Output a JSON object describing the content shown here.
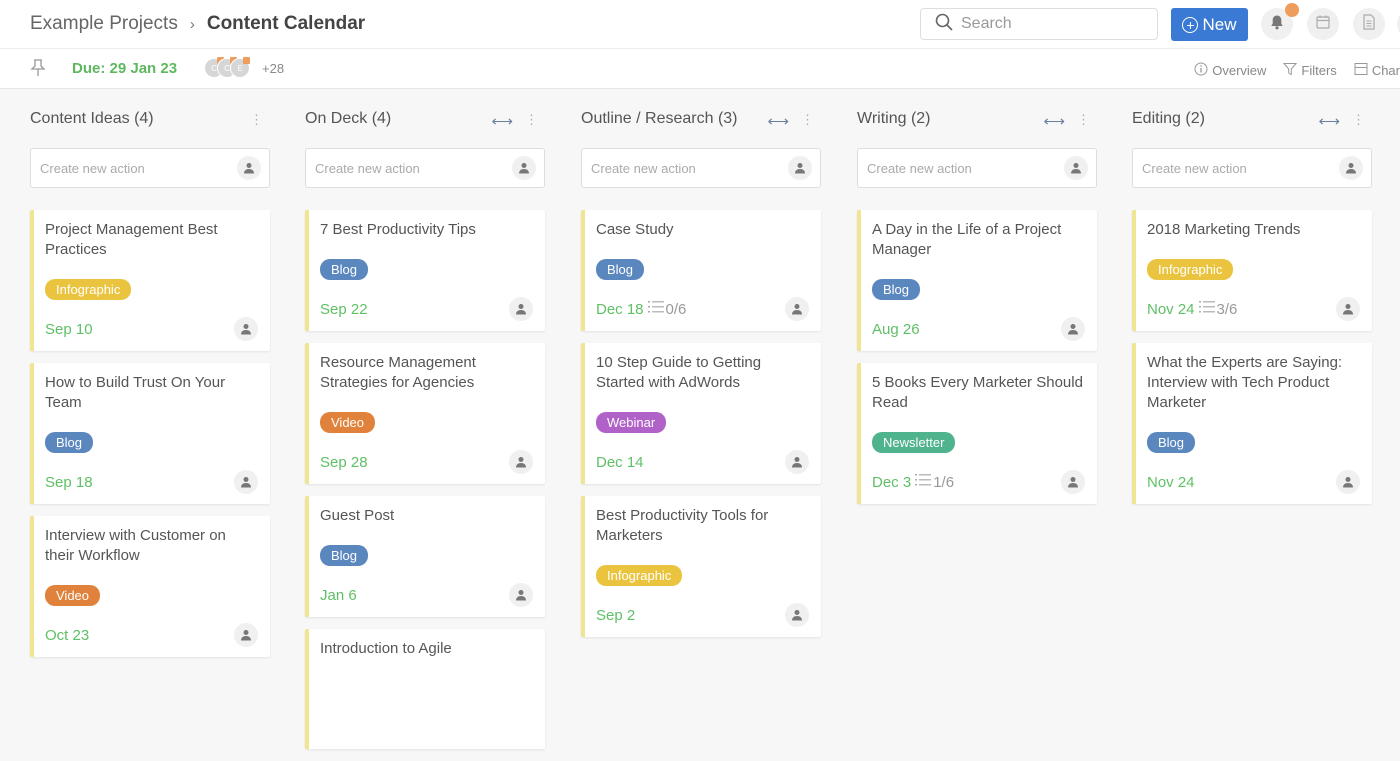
{
  "header": {
    "breadcrumb_parent": "Example Projects",
    "breadcrumb_sep": "›",
    "breadcrumb_current": "Content Calendar",
    "search_placeholder": "Search",
    "new_label": "New",
    "notification_color": "#ee9d5c"
  },
  "subbar": {
    "due": "Due: 29 Jan 23",
    "avatars": [
      "C",
      "C",
      "E"
    ],
    "more_count": "+28",
    "links": {
      "overview": "Overview",
      "filters": "Filters",
      "chart": "Char"
    }
  },
  "colors": {
    "accent": "#3b7ad4",
    "date": "#5fc066",
    "card_border": "#efe592"
  },
  "tag_colors": {
    "Blog": "#5b87bf",
    "Infographic": "#ebc43f",
    "Video": "#e0823b",
    "Webinar": "#b062c8",
    "Newsletter": "#4fb38e"
  },
  "create_placeholder": "Create new action",
  "columns": [
    {
      "title": "Content Ideas (4)",
      "expand": false,
      "cards": [
        {
          "title": "Project Management Best Practices",
          "tag": "Infographic",
          "date": "Sep 10",
          "checklist": ""
        },
        {
          "title": "How to Build Trust On Your Team",
          "tag": "Blog",
          "date": "Sep 18",
          "checklist": ""
        },
        {
          "title": "Interview with Customer on their Workflow",
          "tag": "Video",
          "date": "Oct 23",
          "checklist": ""
        }
      ]
    },
    {
      "title": "On Deck (4)",
      "expand": true,
      "cards": [
        {
          "title": "7 Best Productivity Tips",
          "tag": "Blog",
          "date": "Sep 22",
          "checklist": ""
        },
        {
          "title": "Resource Management Strategies for Agencies",
          "tag": "Video",
          "date": "Sep 28",
          "checklist": ""
        },
        {
          "title": "Guest Post",
          "tag": "Blog",
          "date": "Jan 6",
          "checklist": ""
        },
        {
          "title": "Introduction to Agile",
          "tag": "",
          "date": "",
          "checklist": ""
        }
      ]
    },
    {
      "title": "Outline / Research (3)",
      "expand": true,
      "cards": [
        {
          "title": "Case Study",
          "tag": "Blog",
          "date": "Dec 18",
          "checklist": "0/6"
        },
        {
          "title": "10 Step Guide to Getting Started with AdWords",
          "tag": "Webinar",
          "date": "Dec 14",
          "checklist": ""
        },
        {
          "title": "Best Productivity Tools for Marketers",
          "tag": "Infographic",
          "date": "Sep 2",
          "checklist": ""
        }
      ]
    },
    {
      "title": "Writing (2)",
      "expand": true,
      "cards": [
        {
          "title": "A Day in the Life of a Project Manager",
          "tag": "Blog",
          "date": "Aug 26",
          "checklist": ""
        },
        {
          "title": "5 Books Every Marketer Should Read",
          "tag": "Newsletter",
          "date": "Dec 3",
          "checklist": "1/6"
        }
      ]
    },
    {
      "title": "Editing (2)",
      "expand": true,
      "cards": [
        {
          "title": "2018 Marketing Trends",
          "tag": "Infographic",
          "date": "Nov 24",
          "checklist": "3/6"
        },
        {
          "title": "What the Experts are Saying: Interview with Tech Product Marketer",
          "tag": "Blog",
          "date": "Nov 24",
          "checklist": ""
        }
      ]
    }
  ]
}
